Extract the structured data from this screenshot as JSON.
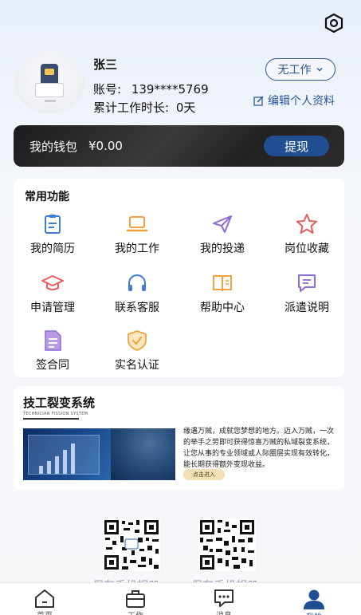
{
  "header": {
    "settings_icon": "settings-hexagon-icon"
  },
  "profile": {
    "name": "张三",
    "account_label": "账号:",
    "account_value": "139****5769",
    "work_time_label": "累计工作时长:",
    "work_time_value": "0天",
    "status_select": "无工作",
    "edit_link": "编辑个人资料"
  },
  "wallet": {
    "label": "我的钱包",
    "amount": "¥0.00",
    "withdraw_label": "提现"
  },
  "functions": {
    "title": "常用功能",
    "items": [
      {
        "label": "我的简历",
        "icon": "resume-icon",
        "color": "#3b7dd8"
      },
      {
        "label": "我的工作",
        "icon": "laptop-icon",
        "color": "#f0a23b"
      },
      {
        "label": "我的投递",
        "icon": "send-icon",
        "color": "#8e6bd6"
      },
      {
        "label": "岗位收藏",
        "icon": "star-icon",
        "color": "#e85b5b"
      },
      {
        "label": "申请管理",
        "icon": "graduation-cap-icon",
        "color": "#e85b5b"
      },
      {
        "label": "联系客服",
        "icon": "headphones-icon",
        "color": "#3b7dd8"
      },
      {
        "label": "帮助中心",
        "icon": "book-icon",
        "color": "#f0a23b"
      },
      {
        "label": "派遣说明",
        "icon": "message-icon",
        "color": "#8e6bd6"
      },
      {
        "label": "签合同",
        "icon": "contract-icon",
        "color": "#8e6bd6"
      },
      {
        "label": "实名认证",
        "icon": "shield-check-icon",
        "color": "#f0a23b"
      }
    ]
  },
  "promo": {
    "title": "技工裂变系统",
    "subtitle": "TECHNICIAN FISSION SYSTEM",
    "description": "缘遇万贼，成就您梦想的地方。迈入万贼，一次的举手之劳即可获得惊喜万贼的私域裂变系统，让您从事的专业领域或人际圈层实现有效转化，能长期获得额外变现收益。",
    "button": "点击进入"
  },
  "qr_codes": [
    {
      "label": "保存手机相册"
    },
    {
      "label": "保存手机相册"
    }
  ],
  "tabbar": {
    "items": [
      {
        "label": "首页",
        "icon": "home-icon"
      },
      {
        "label": "工作",
        "icon": "briefcase-icon"
      },
      {
        "label": "消息",
        "icon": "chat-icon"
      },
      {
        "label": "我的",
        "icon": "user-icon"
      }
    ],
    "active_color": "#1f4e92"
  }
}
